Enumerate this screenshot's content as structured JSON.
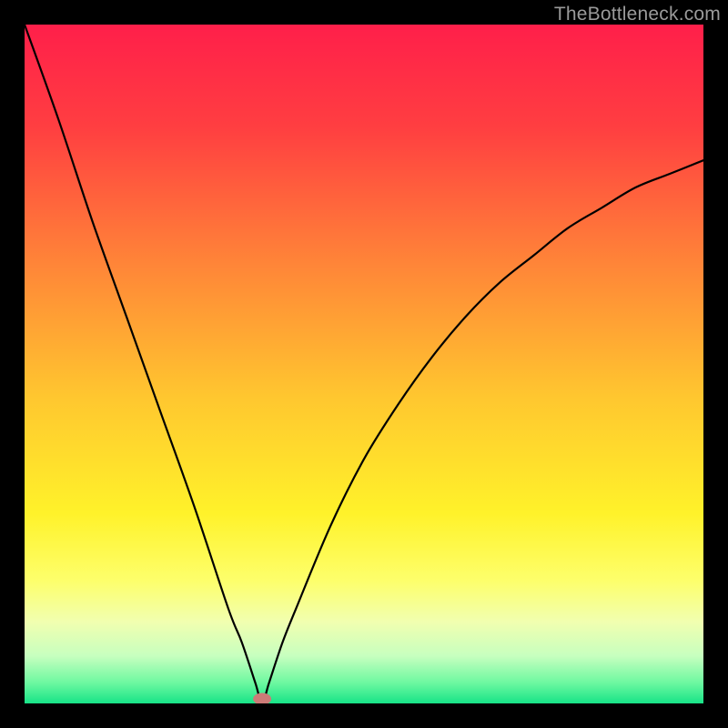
{
  "watermark": "TheBottleneck.com",
  "chart_data": {
    "type": "line",
    "title": "",
    "xlabel": "",
    "ylabel": "",
    "xlim": [
      0,
      100
    ],
    "ylim": [
      0,
      100
    ],
    "x": [
      0,
      5,
      10,
      15,
      20,
      25,
      30,
      32,
      34,
      35,
      36,
      38,
      40,
      45,
      50,
      55,
      60,
      65,
      70,
      75,
      80,
      85,
      90,
      95,
      100
    ],
    "values": [
      100,
      86,
      71,
      57,
      43,
      29,
      14,
      9,
      3,
      0,
      3,
      9,
      14,
      26,
      36,
      44,
      51,
      57,
      62,
      66,
      70,
      73,
      76,
      78,
      80
    ],
    "min_marker": {
      "x": 35,
      "y": 0
    },
    "background_gradient": {
      "stops": [
        {
          "offset": 0.0,
          "color": "#ff1f4a"
        },
        {
          "offset": 0.15,
          "color": "#ff3e41"
        },
        {
          "offset": 0.35,
          "color": "#ff8438"
        },
        {
          "offset": 0.55,
          "color": "#ffc72f"
        },
        {
          "offset": 0.72,
          "color": "#fff22a"
        },
        {
          "offset": 0.82,
          "color": "#fdff6c"
        },
        {
          "offset": 0.88,
          "color": "#f1ffb0"
        },
        {
          "offset": 0.93,
          "color": "#c7ffbf"
        },
        {
          "offset": 0.97,
          "color": "#6cf8a0"
        },
        {
          "offset": 1.0,
          "color": "#17e387"
        }
      ]
    }
  }
}
